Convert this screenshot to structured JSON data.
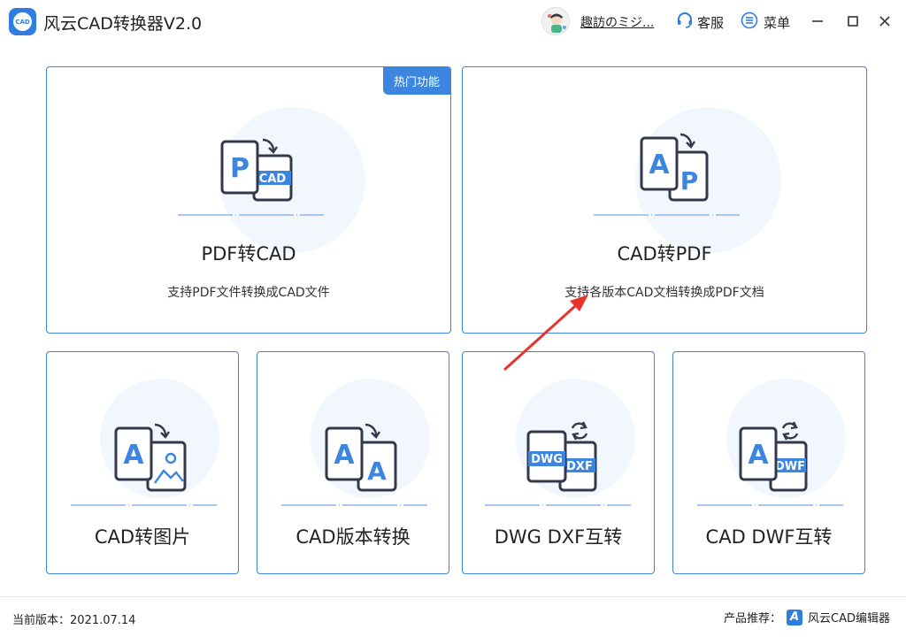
{
  "app": {
    "title": "风云CAD转换器V2.0",
    "logo_text": "CAD",
    "username": "趣訪のミジ...",
    "service_label": "客服",
    "menu_label": "菜单",
    "icons": {
      "service": "headset-icon",
      "menu": "menu-list-icon",
      "minimize": "minimize-icon",
      "maximize": "maximize-icon",
      "close": "close-icon"
    }
  },
  "cards": {
    "pdf_to_cad": {
      "title": "PDF转CAD",
      "desc": "支持PDF文件转换成CAD文件",
      "badge": "热门功能",
      "icon_front": "P",
      "icon_back": "CAD"
    },
    "cad_to_pdf": {
      "title": "CAD转PDF",
      "desc": "支持各版本CAD文档转换成PDF文档",
      "icon_front": "A",
      "icon_back": "P"
    },
    "cad_to_image": {
      "title": "CAD转图片",
      "icon_front": "A"
    },
    "cad_version": {
      "title": "CAD版本转换",
      "icon_front": "A",
      "icon_back": "A"
    },
    "dwg_dxf": {
      "title": "DWG DXF互转",
      "icon_front": "DWG",
      "icon_back": "DXF"
    },
    "cad_dwf": {
      "title": "CAD DWF互转",
      "icon_front": "A",
      "icon_back": "DWF"
    }
  },
  "footer": {
    "version_label": "当前版本：2021.07.14",
    "recommend_label": "产品推荐：",
    "recommend_logo": "A",
    "recommend_product": "风云CAD编辑器"
  },
  "colors": {
    "accent": "#3d86e0",
    "icon_dark": "#33384a",
    "annotation": "#e8322b"
  }
}
